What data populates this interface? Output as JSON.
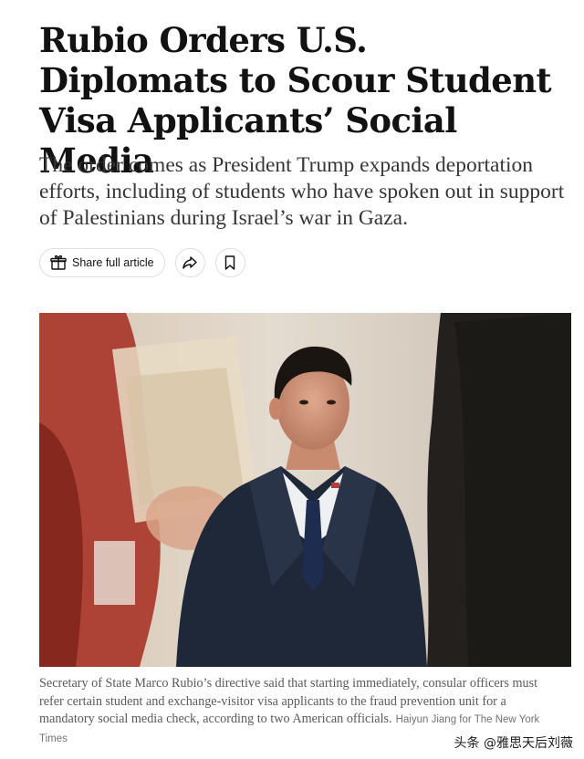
{
  "article": {
    "headline": "Rubio Orders U.S. Diplomats to Scour Student Visa Applicants’ Social Media",
    "summary": "The order comes as President Trump expands deportation efforts, including of students who have spoken out in support of Palestinians during Israel’s war in Gaza."
  },
  "share_bar": {
    "share_label": "Share full article",
    "share_icon": "gift-icon",
    "forward_icon": "share-arrow-icon",
    "save_icon": "bookmark-icon"
  },
  "photo": {
    "caption": "Secretary of State Marco Rubio’s directive said that starting immediately, consular officers must refer certain student and exchange-visitor visa applicants to the fraud prevention unit for a mandatory social media check, according to two American officials.",
    "credit": "Haiyun Jiang for The New York Times"
  },
  "watermark": "头条 @雅思天后刘薇",
  "colors": {
    "headline": "#121212",
    "summary": "#363636",
    "caption": "#5a5a5a",
    "pill_border": "#dfdfdf"
  }
}
